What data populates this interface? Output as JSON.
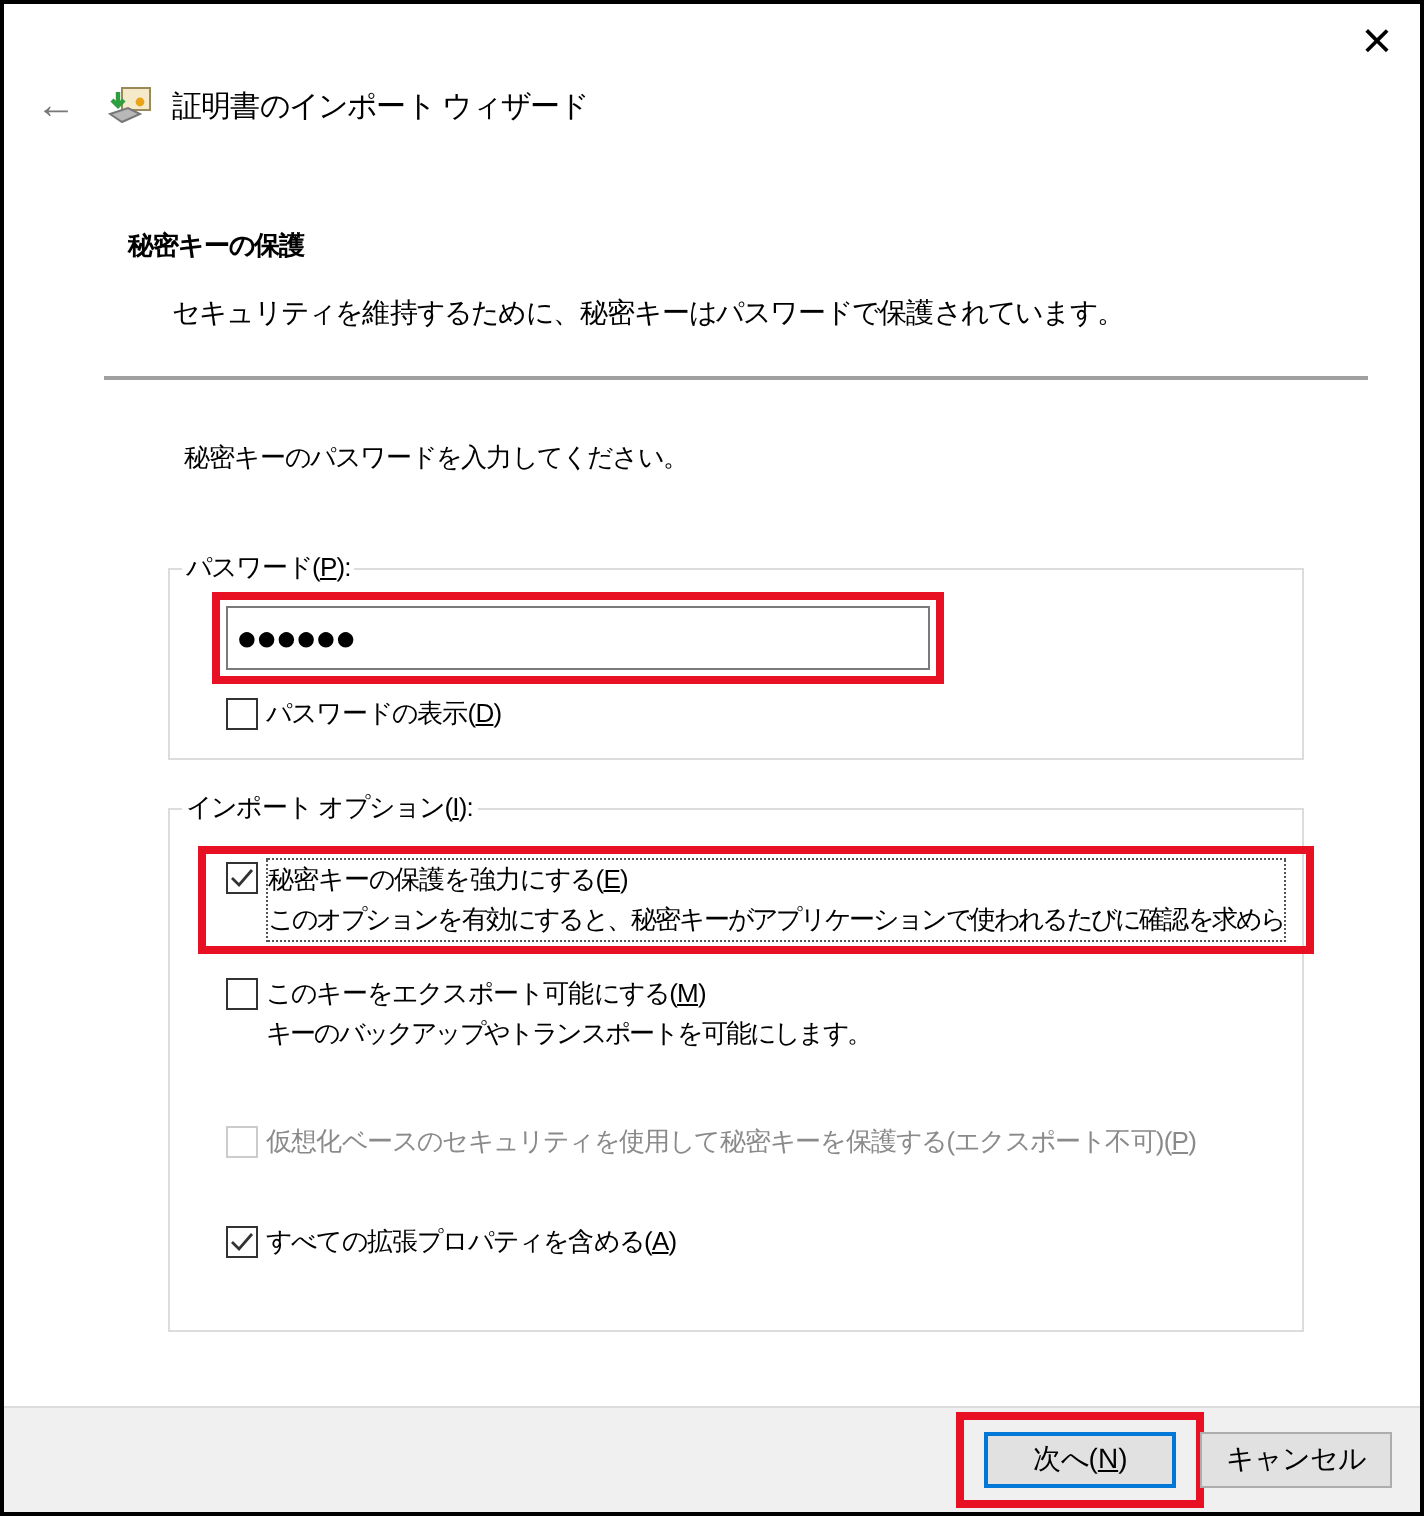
{
  "window": {
    "title": "証明書のインポート ウィザード",
    "close": "×",
    "back": "←"
  },
  "header": {
    "title": "秘密キーの保護",
    "subtitle": "セキュリティを維持するために、秘密キーはパスワードで保護されています。"
  },
  "instruction": "秘密キーのパスワードを入力してください。",
  "password_group": {
    "label": {
      "before": "パスワード(",
      "key": "P",
      "after": "):"
    },
    "value": "●●●●●●",
    "highlighted": true,
    "show_password": {
      "label": {
        "before": "パスワードの表示(",
        "key": "D",
        "after": ")"
      },
      "checked": false,
      "disabled": false
    }
  },
  "options_group": {
    "label": {
      "before": "インポート オプション(",
      "key": "I",
      "after": "):"
    },
    "options": [
      {
        "label": {
          "before": "秘密キーの保護を強力にする(",
          "key": "E",
          "after": ")"
        },
        "description": "このオプションを有効にすると、秘密キーがアプリケーションで使われるたびに確認を求めら",
        "checked": true,
        "disabled": false,
        "highlighted": true,
        "focused": true
      },
      {
        "label": {
          "before": "このキーをエクスポート可能にする(",
          "key": "M",
          "after": ")"
        },
        "description": "キーのバックアップやトランスポートを可能にします。",
        "checked": false,
        "disabled": false,
        "highlighted": false,
        "focused": false
      },
      {
        "label": {
          "before": "仮想化ベースのセキュリティを使用して秘密キーを保護する(エクスポート不可)(",
          "key": "P",
          "after": ")"
        },
        "checked": false,
        "disabled": true,
        "highlighted": false,
        "focused": false
      },
      {
        "label": {
          "before": "すべての拡張プロパティを含める(",
          "key": "A",
          "after": ")"
        },
        "checked": true,
        "disabled": false,
        "highlighted": false,
        "focused": false
      }
    ]
  },
  "buttons": [
    {
      "label": {
        "before": "次へ(",
        "key": "N",
        "after": ")"
      },
      "default": true,
      "highlighted": true
    },
    {
      "label": {
        "before": "キャンセル"
      },
      "default": false,
      "highlighted": false
    }
  ]
}
